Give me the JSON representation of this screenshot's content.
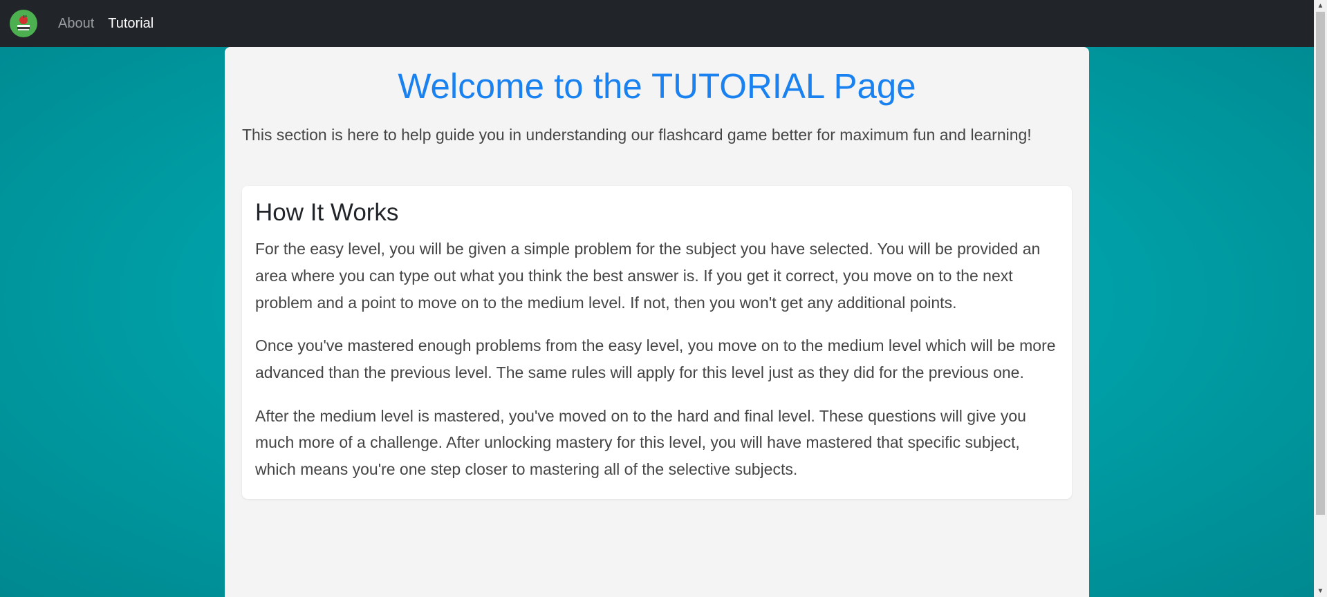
{
  "nav": {
    "logo_icon": "book-apple-logo-icon",
    "links": [
      {
        "label": "About"
      },
      {
        "label": "Tutorial"
      }
    ]
  },
  "main": {
    "title": "Welcome to the TUTORIAL Page",
    "intro": "This section is here to help guide you in understanding our flashcard game better for maximum fun and learning!",
    "card": {
      "title": "How It Works",
      "paragraphs": [
        "For the easy level, you will be given a simple problem for the subject you have selected. You will be provided an area where you can type out what you think the best answer is. If you get it correct, you move on to the next problem and a point to move on to the medium level. If not, then you won't get any additional points.",
        "Once you've mastered enough problems from the easy level, you move on to the medium level which will be more advanced than the previous level. The same rules will apply for this level just as they did for the previous one.",
        "After the medium level is mastered, you've moved on to the hard and final level. These questions will give you much more of a challenge. After unlocking mastery for this level, you will have mastered that specific subject, which means you're one step closer to mastering all of the selective subjects."
      ]
    }
  },
  "colors": {
    "navbar_bg": "#212529",
    "background_teal": "#00a3ab",
    "title_blue": "#1a82f0",
    "content_bg": "#f4f4f4",
    "card_bg": "#ffffff"
  },
  "scrollbar": {
    "up_icon": "scroll-up-arrow-icon",
    "down_icon": "scroll-down-arrow-icon"
  }
}
